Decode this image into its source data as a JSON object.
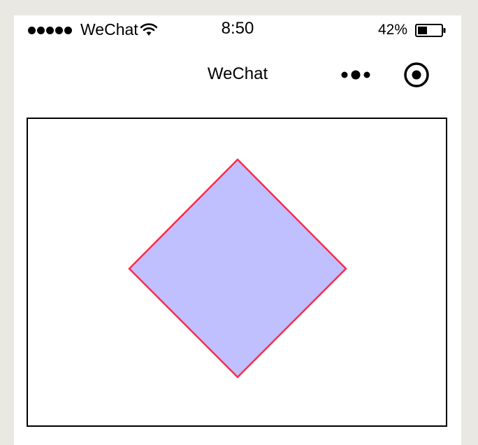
{
  "status_bar": {
    "signal_dots": 5,
    "carrier": "WeChat",
    "time": "8:50",
    "battery_percent": "42%",
    "battery_level": 0.42
  },
  "nav": {
    "title": "WeChat"
  },
  "canvas": {
    "shape": "diamond",
    "fill_color": "#c0bfff",
    "stroke_color": "#ff2a4a"
  },
  "colors": {
    "page_bg": "#e9e8e3",
    "surface": "#ffffff",
    "text": "#000000"
  }
}
